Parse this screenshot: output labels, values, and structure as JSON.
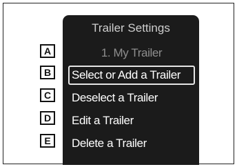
{
  "screen": {
    "title": "Trailer Settings"
  },
  "menu": {
    "items": [
      {
        "label": "1. My Trailer"
      },
      {
        "label": "Select or Add a Trailer"
      },
      {
        "label": "Deselect a Trailer"
      },
      {
        "label": "Edit a Trailer"
      },
      {
        "label": "Delete a Trailer"
      }
    ]
  },
  "callouts": [
    "A",
    "B",
    "C",
    "D",
    "E"
  ],
  "colors": {
    "screen_background": "#1b1b1b",
    "menu_text": "#ffffff",
    "header_text": "#8e8e8e",
    "selection_border": "#e6e6e6"
  }
}
